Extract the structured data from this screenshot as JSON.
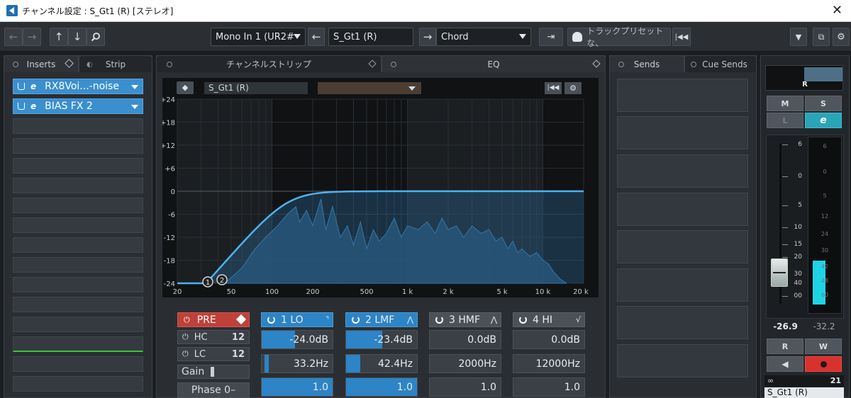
{
  "window": {
    "title": "チャンネル設定 : S_Gt1 (R) [ステレオ]",
    "close_glyph": "✕"
  },
  "toolbar": {
    "input_routing": "Mono In 1 (UR2#",
    "channel_name": "S_Gt1 (R)",
    "output_routing": "Chord",
    "track_preset_placeholder": "トラックプリセットな、"
  },
  "left_tabs": {
    "inserts": "Inserts",
    "strip": "Strip"
  },
  "inserts": [
    {
      "name": "RX8Voi...-noise"
    },
    {
      "name": "BIAS FX 2"
    }
  ],
  "center_tabs": {
    "channel_strip": "チャンネルストリップ",
    "eq": "EQ"
  },
  "eq": {
    "channel_label": "S_Gt1 (R)",
    "preset": "",
    "y_ticks": [
      "+24",
      "+18",
      "+12",
      "+6",
      "0",
      "-6",
      "-12",
      "-18",
      "-24"
    ],
    "x_ticks": [
      "20",
      "50",
      "100",
      "200",
      "500",
      "1 k",
      "2 k",
      "5 k",
      "10 k",
      "20 k"
    ],
    "node_labels": [
      "1",
      "2"
    ]
  },
  "pre": {
    "label": "PRE",
    "hc_label": "HC",
    "hc_slope": "12",
    "lc_label": "LC",
    "lc_slope": "12",
    "gain_label": "Gain",
    "phase_label": "Phase 0–"
  },
  "bands": [
    {
      "name": "1 LO",
      "on": true,
      "gain": "-24.0dB",
      "freq": "33.2Hz",
      "q": "1.0",
      "gain_fill": 0.47,
      "freq_fill": 0.05,
      "q_fill": 1.0
    },
    {
      "name": "2 LMF",
      "on": true,
      "gain": "-23.4dB",
      "freq": "42.4Hz",
      "q": "1.0",
      "gain_fill": 0.51,
      "freq_fill": 0.2,
      "q_fill": 1.0
    },
    {
      "name": "3 HMF",
      "on": false,
      "gain": "0.0dB",
      "freq": "2000Hz",
      "q": "1.0",
      "gain_fill": 0,
      "freq_fill": 0,
      "q_fill": 0
    },
    {
      "name": "4 HI",
      "on": false,
      "gain": "0.0dB",
      "freq": "12000Hz",
      "q": "1.0",
      "gain_fill": 0,
      "freq_fill": 0,
      "q_fill": 0
    }
  ],
  "sends_tabs": {
    "sends": "Sends",
    "cue_sends": "Cue Sends"
  },
  "mixer": {
    "pan_label": "R",
    "mute": "M",
    "solo": "S",
    "listen": "L",
    "edit": "e",
    "fader_scale": [
      "6",
      "0",
      "5",
      "10",
      "15",
      "20",
      "30",
      "40",
      "00"
    ],
    "meter_scale": [
      "6",
      "0",
      "5",
      "12",
      "24",
      "30",
      "42",
      "48",
      "60"
    ],
    "fader_value": "-26.9",
    "peak_value": "-32.2",
    "read": "R",
    "write": "W",
    "channel_number": "21",
    "channel_name": "S_Gt1 (R)",
    "colors": {
      "meter": "#1fd3e6",
      "record": "#d9312d",
      "edit": "#2aa5b8"
    }
  }
}
